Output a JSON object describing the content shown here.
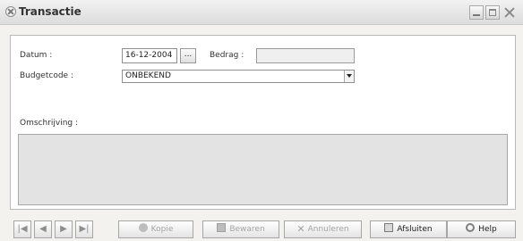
{
  "window": {
    "title": "Transactie"
  },
  "form": {
    "datum_label": "Datum :",
    "datum_value": "16-12-2004",
    "date_picker_label": "...",
    "bedrag_label": "Bedrag :",
    "bedrag_value": "",
    "budgetcode_label": "Budgetcode :",
    "budgetcode_value": "ONBEKEND",
    "omschrijving_label": "Omschrijving :",
    "omschrijving_value": ""
  },
  "navigation": {
    "first_icon": "first-record-icon",
    "prev_icon": "previous-record-icon",
    "next_icon": "next-record-icon",
    "last_icon": "last-record-icon"
  },
  "actions": {
    "kopie": "Kopie",
    "bewaren": "Bewaren",
    "annuleren": "Annuleren",
    "afsluiten": "Afsluiten",
    "help": "Help"
  }
}
